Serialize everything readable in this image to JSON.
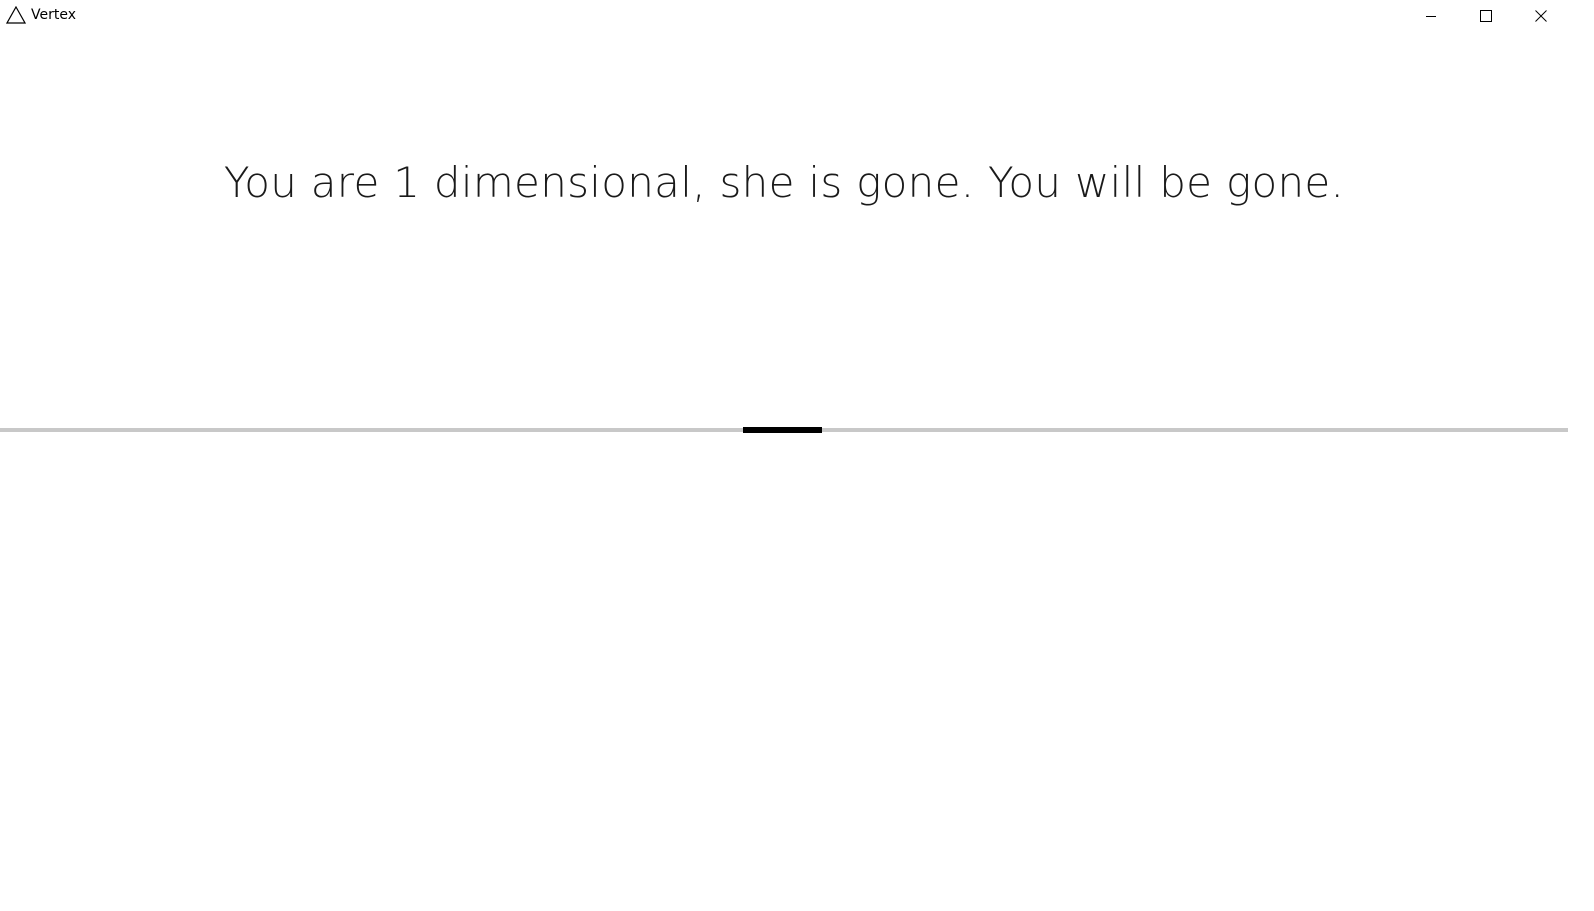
{
  "window": {
    "title": "Vertex",
    "icon": "triangle-outline-icon",
    "controls": {
      "minimize_icon": "minimize-icon",
      "maximize_icon": "maximize-icon",
      "close_icon": "close-icon"
    }
  },
  "game": {
    "message": "You are 1 dimensional, she is gone. You will be gone.",
    "colors": {
      "line": "#c8c8c8",
      "player": "#000000",
      "text": "#1a1a1a",
      "background": "#ffffff"
    }
  }
}
